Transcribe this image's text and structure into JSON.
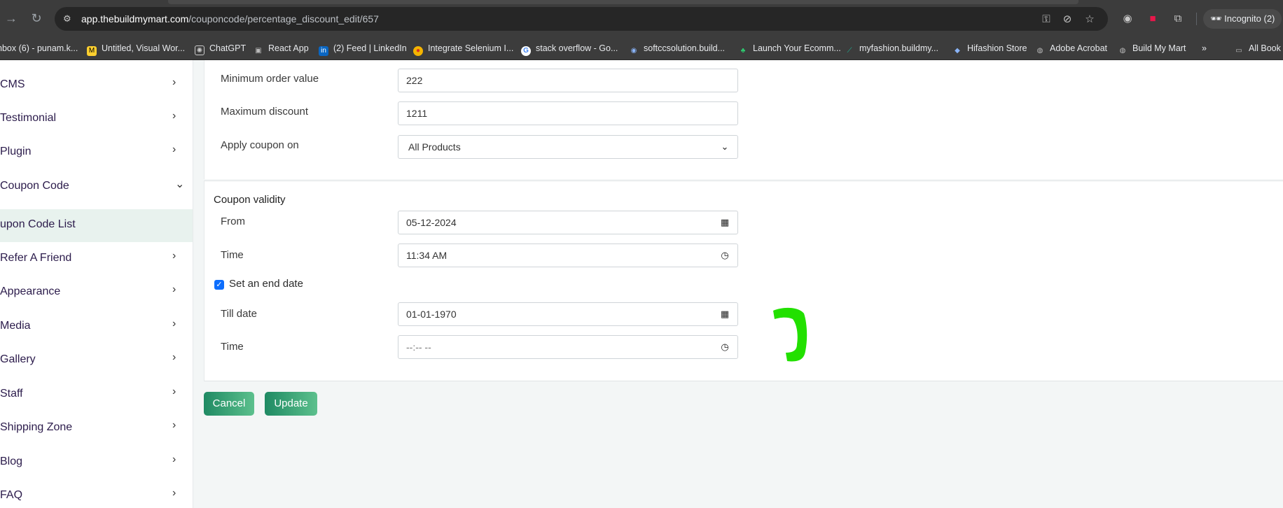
{
  "browser": {
    "url_host": "app.thebuildmymart.com",
    "url_path": "/couponcode/percentage_discount_edit/657",
    "incognito_label": "Incognito (2)",
    "bookmarks": [
      {
        "label": "nbox (6) - punam.k...",
        "icon": "mail-icon"
      },
      {
        "label": "Untitled, Visual Wor...",
        "icon": "miro-icon"
      },
      {
        "label": "ChatGPT",
        "icon": "chatgpt-icon"
      },
      {
        "label": "React App",
        "icon": "react-icon"
      },
      {
        "label": "(2) Feed | LinkedIn",
        "icon": "linkedin-icon"
      },
      {
        "label": "Integrate Selenium I...",
        "icon": "chrome-icon"
      },
      {
        "label": "stack overflow - Go...",
        "icon": "google-icon"
      },
      {
        "label": "softccsolution.build...",
        "icon": "site-icon"
      },
      {
        "label": "Launch Your Ecomm...",
        "icon": "site-icon"
      },
      {
        "label": "myfashion.buildmy...",
        "icon": "site-icon"
      },
      {
        "label": "Hifashion Store",
        "icon": "site-icon"
      },
      {
        "label": "Adobe Acrobat",
        "icon": "globe-icon"
      },
      {
        "label": "Build My Mart",
        "icon": "globe-icon"
      },
      {
        "label": "All Book",
        "icon": "folder-icon"
      }
    ]
  },
  "sidebar": {
    "items": [
      {
        "label": "CMS",
        "expanded": false
      },
      {
        "label": "Testimonial",
        "expanded": false
      },
      {
        "label": "Plugin",
        "expanded": false
      },
      {
        "label": "Coupon Code",
        "expanded": true
      },
      {
        "label": "upon Code List",
        "active": true
      },
      {
        "label": " Refer A Friend",
        "expanded": false
      },
      {
        "label": "Appearance",
        "expanded": false
      },
      {
        "label": "Media",
        "expanded": false
      },
      {
        "label": "Gallery",
        "expanded": false
      },
      {
        "label": "Staff",
        "expanded": false
      },
      {
        "label": "Shipping Zone",
        "expanded": false
      },
      {
        "label": "Blog",
        "expanded": false
      },
      {
        "label": "FAQ",
        "expanded": false
      }
    ]
  },
  "form": {
    "min_order": {
      "label": "Minimum order value",
      "value": "222"
    },
    "max_discount": {
      "label": "Maximum discount",
      "value": "1211"
    },
    "apply_on": {
      "label": "Apply coupon on",
      "value": "All Products"
    },
    "validity_title": "Coupon validity",
    "from": {
      "label": "From",
      "value": "05-12-2024"
    },
    "from_time": {
      "label": "Time",
      "value": "11:34  AM"
    },
    "end_date_check": {
      "label": "Set an end date",
      "checked": true
    },
    "till_date": {
      "label": "Till date",
      "value": "01-01-1970"
    },
    "till_time": {
      "label": "Time",
      "value": "--:-- --"
    }
  },
  "actions": {
    "cancel": "Cancel",
    "update": "Update"
  },
  "colors": {
    "accent": "#1f8a63",
    "checkbox": "#0d6efd",
    "scribble": "#22e000"
  }
}
